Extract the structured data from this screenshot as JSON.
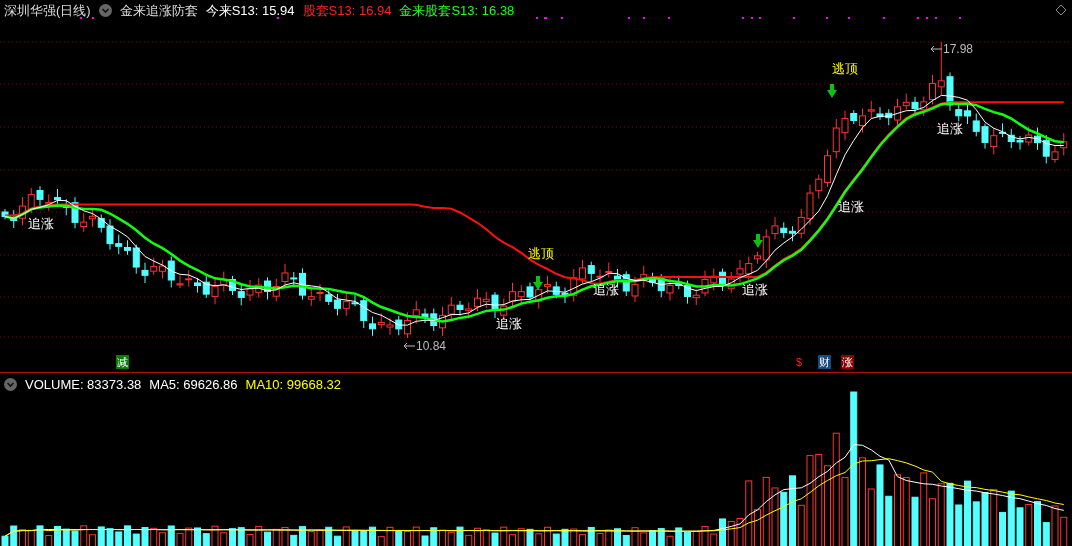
{
  "header": {
    "stock": "深圳华强(日线)",
    "indicator": "金来追涨防套",
    "values": [
      {
        "label": "今来S13: 15.94",
        "color": "#ffffff"
      },
      {
        "label": "股套S13: 16.94",
        "color": "#ff2020"
      },
      {
        "label": "金来股套S13: 16.38",
        "color": "#20ff20"
      }
    ]
  },
  "signals": [
    {
      "kind": "chase",
      "text": "追涨"
    },
    {
      "kind": "escape",
      "text": "逃顶"
    },
    {
      "kind": "chase",
      "text": "追涨"
    },
    {
      "kind": "chase",
      "text": "追涨"
    },
    {
      "kind": "chase",
      "text": "追涨"
    },
    {
      "kind": "escape",
      "text": "逃顶"
    },
    {
      "kind": "chase",
      "text": "追涨"
    },
    {
      "kind": "chase",
      "text": "追涨"
    }
  ],
  "price_marks": [
    {
      "kind": "high",
      "text": "17.98"
    },
    {
      "kind": "low",
      "text": "10.84"
    }
  ],
  "events": [
    {
      "kind": "reduce",
      "text": "减"
    },
    {
      "kind": "dollar",
      "text": "$"
    },
    {
      "kind": "finance",
      "text": "财"
    },
    {
      "kind": "rise",
      "text": "涨"
    }
  ],
  "volume": {
    "label": "VOLUME: 83373.38",
    "values": [
      {
        "label": "MA5: 69626.86",
        "color": "#ffffff"
      },
      {
        "label": "MA10: 99668.32",
        "color": "#ffff00"
      }
    ]
  }
}
